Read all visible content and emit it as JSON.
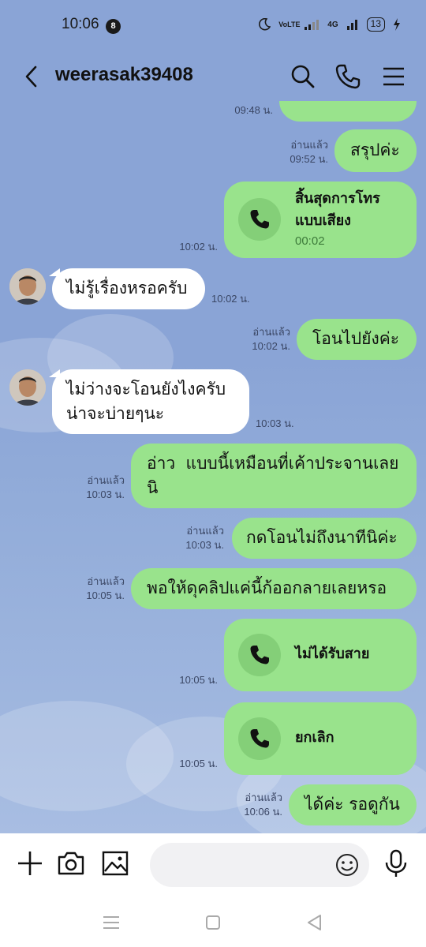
{
  "status_bar": {
    "time": "10:06",
    "notification_count": "8",
    "network_1": "VoLTE",
    "network_2": "4G",
    "battery": "13"
  },
  "header": {
    "title": "weerasak39408"
  },
  "messages": {
    "partial_time": "09:48 น.",
    "m1": {
      "text": "สรุปค่ะ",
      "read": "อ่านแล้ว",
      "time": "09:52 น."
    },
    "m2": {
      "title_line1": "สิ้นสุดการโทร",
      "title_line2": "แบบเสียง",
      "duration": "00:02",
      "time": "10:02 น."
    },
    "m3": {
      "text": "ไม่รู้เรื่องหรอครับ",
      "time": "10:02 น."
    },
    "m4": {
      "text": "โอนไปยังค่ะ",
      "read": "อ่านแล้ว",
      "time": "10:02 น."
    },
    "m5": {
      "line1": "ไม่ว่างจะโอนยังไงครับ",
      "line2": "น่าจะบ่ายๆนะ",
      "time": "10:03 น."
    },
    "m6": {
      "line1": "อ่าว  แบบนี้เหมือนที่เค้าประจานเลย",
      "line2": "นิ",
      "read": "อ่านแล้ว",
      "time": "10:03 น."
    },
    "m7": {
      "text": "กดโอนไม่ถึงนาทีนิค่ะ",
      "read": "อ่านแล้ว",
      "time": "10:03 น."
    },
    "m8": {
      "text": "พอให้ดุคลิปแค่นี้ก้ออกลายเลยหรอ",
      "read": "อ่านแล้ว",
      "time": "10:05 น."
    },
    "m9": {
      "label": "ไม่ได้รับสาย",
      "time": "10:05 น."
    },
    "m10": {
      "label": "ยกเลิก",
      "time": "10:05 น."
    },
    "m11": {
      "text": "ได้ค่ะ รอดูกัน",
      "read": "อ่านแล้ว",
      "time": "10:06 น."
    }
  },
  "colors": {
    "background": "#8aa4d6",
    "outgoing_bubble": "#99e38c",
    "incoming_bubble": "#ffffff"
  },
  "icons": {
    "back": "chevron-left-icon",
    "search": "search-icon",
    "call": "phone-icon",
    "menu": "hamburger-menu-icon",
    "add": "plus-icon",
    "camera": "camera-icon",
    "image": "image-icon",
    "emoji": "emoji-icon",
    "mic": "microphone-icon"
  }
}
